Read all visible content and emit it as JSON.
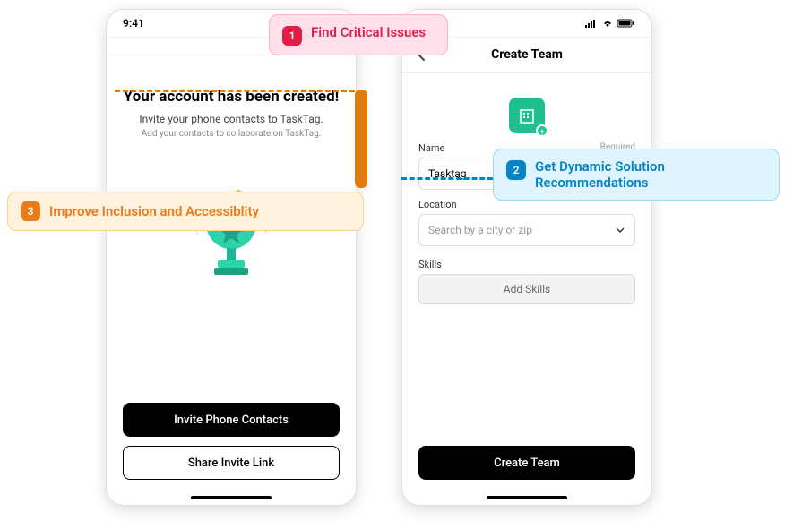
{
  "status_time": "9:41",
  "left": {
    "title": "Your account has been created!",
    "subtitle": "Invite your phone contacts to TaskTag.",
    "subtitle2": "Add your contacts to collaborate on TaskTag.",
    "invite_btn": "Invite Phone Contacts",
    "share_btn": "Share Invite Link"
  },
  "right": {
    "header_title": "Create Team",
    "name_label": "Name",
    "required_label": "Required",
    "name_value": "Tasktag",
    "location_label": "Location",
    "location_placeholder": "Search by a city or zip",
    "skills_label": "Skills",
    "add_skills": "Add Skills",
    "create_btn": "Create Team"
  },
  "callouts": {
    "c1_num": "1",
    "c1_text": "Find Critical Issues",
    "c2_num": "2",
    "c2_text": "Get Dynamic Solution Recommendations",
    "c3_num": "3",
    "c3_text": "Improve Inclusion and Accessiblity"
  }
}
